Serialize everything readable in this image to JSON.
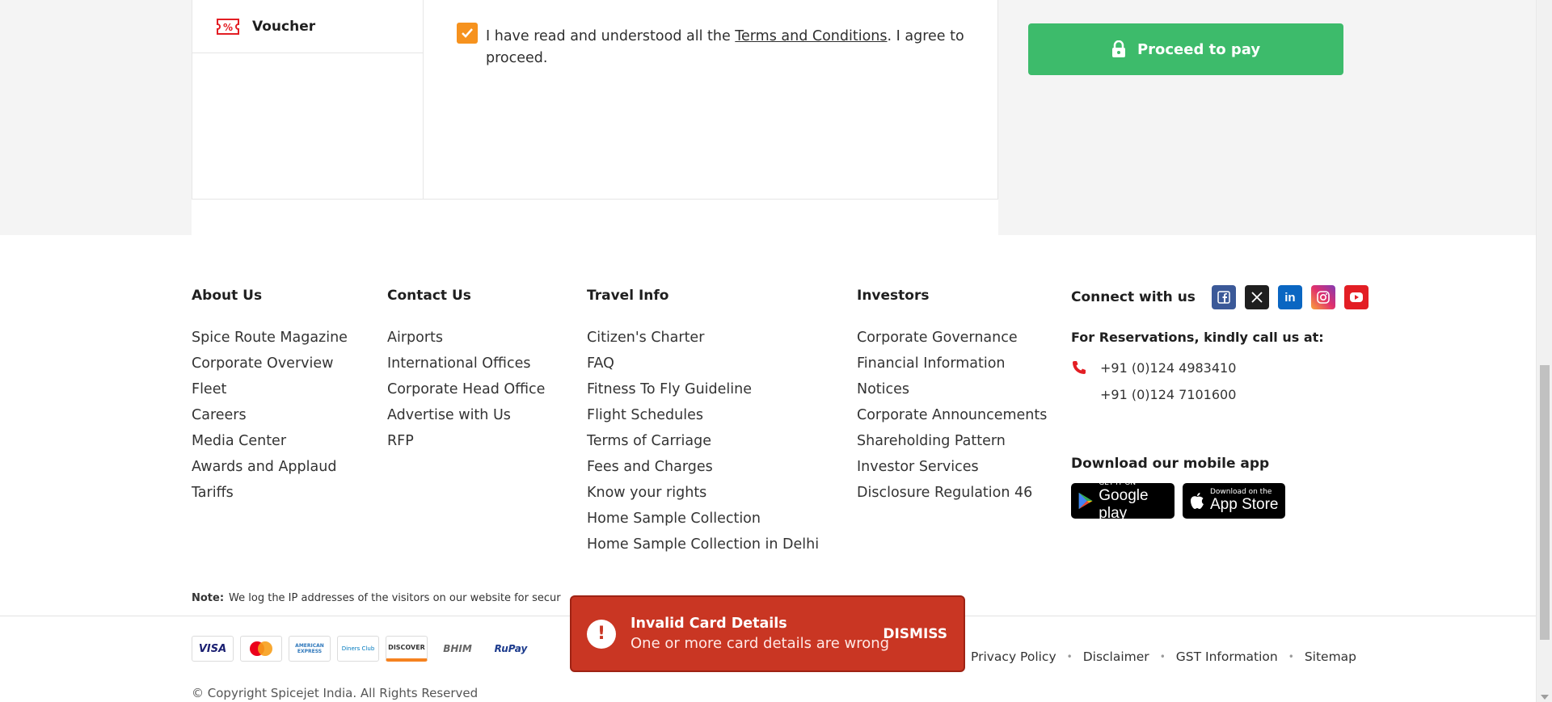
{
  "checkout": {
    "voucher_label": "Voucher",
    "terms_prefix": "I have read and understood all the ",
    "terms_link": "Terms and Conditions",
    "terms_suffix": ". I agree to proceed.",
    "terms_checked": true,
    "proceed_label": "Proceed to pay"
  },
  "footer": {
    "columns": [
      {
        "title": "About Us",
        "items": [
          "Spice Route Magazine",
          "Corporate Overview",
          "Fleet",
          "Careers",
          "Media Center",
          "Awards and Applaud",
          "Tariffs"
        ]
      },
      {
        "title": "Contact Us",
        "items": [
          "Airports",
          "International Offices",
          "Corporate Head Office",
          "Advertise with Us",
          "RFP"
        ]
      },
      {
        "title": "Travel Info",
        "items": [
          "Citizen's Charter",
          "FAQ",
          "Fitness To Fly Guideline",
          "Flight Schedules",
          "Terms of Carriage",
          "Fees and Charges",
          "Know your rights",
          "Home Sample Collection",
          "Home Sample Collection in Delhi"
        ]
      },
      {
        "title": "Investors",
        "items": [
          "Corporate Governance",
          "Financial Information",
          "Notices",
          "Corporate Announcements",
          "Shareholding Pattern",
          "Investor Services",
          "Disclosure Regulation 46"
        ]
      }
    ],
    "connect": {
      "title": "Connect with us",
      "social": [
        "facebook-icon",
        "x-icon",
        "linkedin-icon",
        "instagram-icon",
        "youtube-icon"
      ],
      "reservations_title": "For Reservations, kindly call us at:",
      "phone1": "+91 (0)124 4983410",
      "phone2": "+91 (0)124 7101600",
      "app_title": "Download our mobile app",
      "google_small": "GET IT ON",
      "google_big": "Google play",
      "apple_small": "Download on the",
      "apple_big": "App Store"
    },
    "note_label": "Note:",
    "note_text": "We log the IP addresses of the visitors on our website for secur",
    "payment_logos": [
      "VISA",
      "MasterCard",
      "AMERICAN EXPRESS",
      "Diners Club",
      "DISCOVER",
      "BHIM",
      "RuPay"
    ],
    "copyright": "© Copyright Spicejet India. All Rights Reserved",
    "bottom_links": [
      "Privacy Policy",
      "Disclaimer",
      "GST Information",
      "Sitemap"
    ]
  },
  "toast": {
    "title": "Invalid Card Details",
    "message": "One or more card details are wrong",
    "dismiss": "DISMISS"
  },
  "colors": {
    "accent_green": "#3dbb6b",
    "checkbox_orange": "#f6921e",
    "error_red": "#c93623",
    "brand_red": "#e31e24"
  }
}
